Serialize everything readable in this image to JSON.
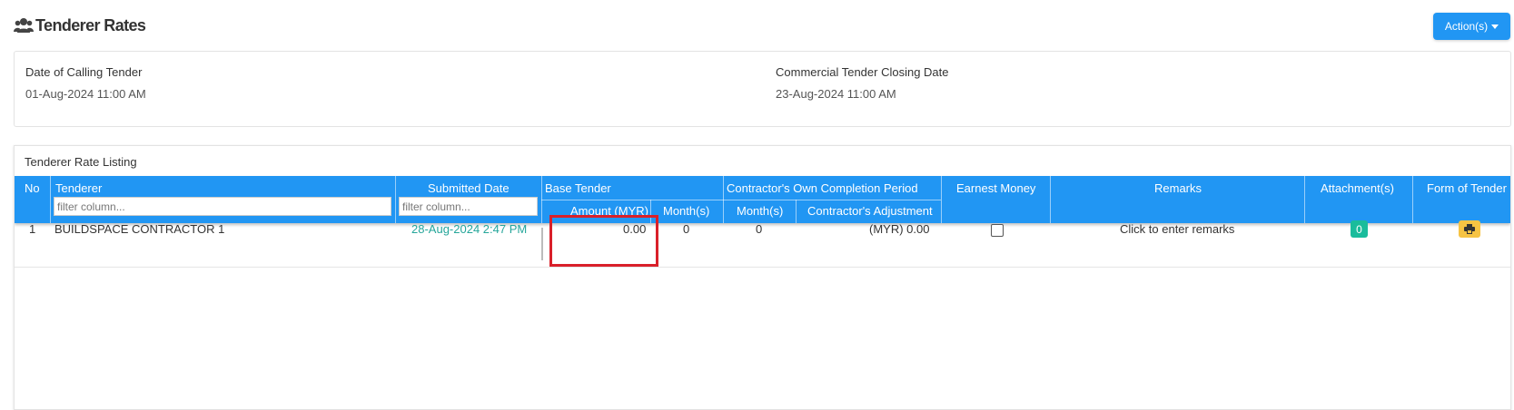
{
  "page": {
    "title": "Tenderer Rates",
    "icon": "users-icon"
  },
  "actions": {
    "label": "Action(s)"
  },
  "info": {
    "calling_label": "Date of Calling Tender",
    "calling_value": "01-Aug-2024 11:00 AM",
    "closing_label": "Commercial Tender Closing Date",
    "closing_value": "23-Aug-2024 11:00 AM"
  },
  "listing": {
    "title": "Tenderer Rate Listing",
    "headers": {
      "no": "No",
      "tenderer": "Tenderer",
      "submitted_date": "Submitted Date",
      "base_tender": "Base Tender",
      "amount": "Amount (MYR)",
      "months": "Month(s)",
      "completion_period": "Contractor's Own Completion Period",
      "cop_months": "Month(s)",
      "adjustment": "Contractor's Adjustment",
      "earnest_money": "Earnest Money",
      "remarks": "Remarks",
      "attachments": "Attachment(s)",
      "form_of_tender": "Form of Tender"
    },
    "filter_placeholder": "filter column...",
    "rows": [
      {
        "no": "1",
        "tenderer": "BUILDSPACE CONTRACTOR 1",
        "submitted_date": "28-Aug-2024 2:47 PM",
        "amount": "0.00",
        "months": "0",
        "cop_months": "0",
        "adjustment": "(MYR) 0.00",
        "earnest_money_checked": false,
        "remarks": "Click to enter remarks",
        "attachments": "0"
      }
    ]
  },
  "colors": {
    "accent": "#2196f3",
    "submitted_date": "#26a69a",
    "attachment_badge": "#1abc9c",
    "form_badge": "#f6c343",
    "highlight": "#d9202a"
  }
}
